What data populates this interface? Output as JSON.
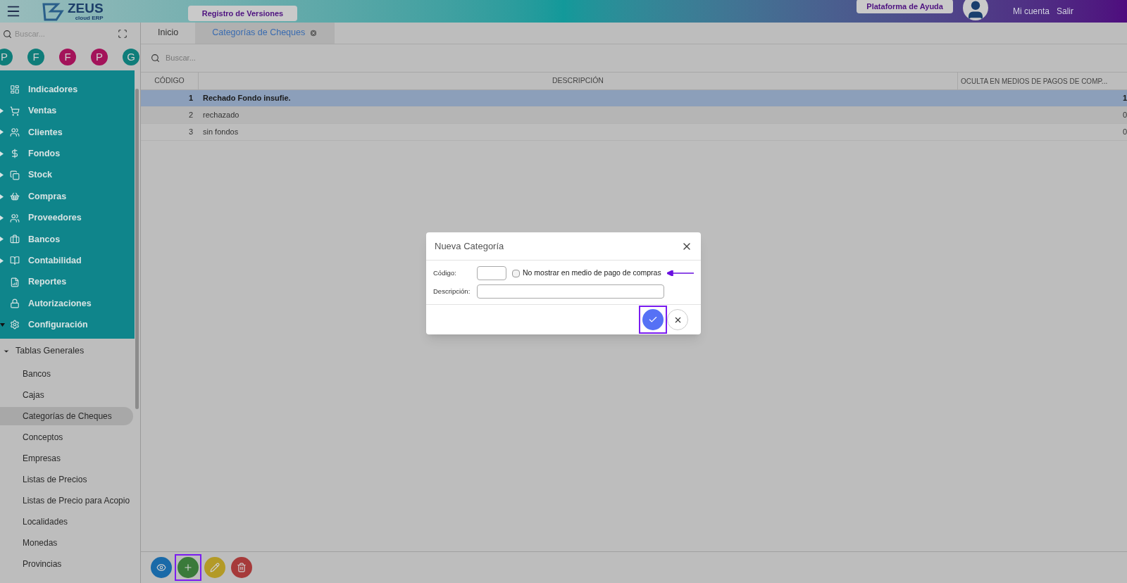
{
  "header": {
    "logo": {
      "name": "ZEUS",
      "tagline": "cloud ERP"
    },
    "versions_button": "Registro de Versiones",
    "help_button": "Plataforma de Ayuda",
    "links": [
      "Mi cuenta",
      "Salir"
    ]
  },
  "sidebar": {
    "search": {
      "placeholder": "Buscar..."
    },
    "avatars": [
      {
        "letter": "P",
        "color": "#0f7d7a"
      },
      {
        "letter": "F",
        "color": "#0f7d7a"
      },
      {
        "letter": "F",
        "color": "#a3135a"
      },
      {
        "letter": "P",
        "color": "#a3135a"
      },
      {
        "letter": "G",
        "color": "#0f7d7a"
      }
    ],
    "menu": [
      {
        "label": "Indicadores"
      },
      {
        "label": "Ventas",
        "expanded": false
      },
      {
        "label": "Clientes",
        "expanded": false
      },
      {
        "label": "Fondos",
        "expanded": false
      },
      {
        "label": "Stock",
        "expanded": false
      },
      {
        "label": "Compras",
        "expanded": false
      },
      {
        "label": "Proveedores",
        "expanded": false
      },
      {
        "label": "Bancos",
        "expanded": false
      },
      {
        "label": "Contabilidad",
        "expanded": false
      },
      {
        "label": "Reportes"
      },
      {
        "label": "Autorizaciones"
      },
      {
        "label": "Configuración",
        "expanded": true
      }
    ],
    "submenu": {
      "label": "Tablas Generales",
      "expanded": true,
      "children": [
        {
          "label": "Bancos",
          "selected": false
        },
        {
          "label": "Cajas",
          "selected": false
        },
        {
          "label": "Categorías de Cheques",
          "selected": true
        },
        {
          "label": "Conceptos",
          "selected": false
        },
        {
          "label": "Empresas",
          "selected": false
        },
        {
          "label": "Listas de Precios",
          "selected": false
        },
        {
          "label": "Listas de Precio para Acopio",
          "selected": false
        },
        {
          "label": "Localidades",
          "selected": false
        },
        {
          "label": "Monedas",
          "selected": false
        },
        {
          "label": "Provincias",
          "selected": false
        }
      ]
    }
  },
  "tabs": [
    {
      "label": "Inicio",
      "selected": false,
      "closable": false
    },
    {
      "label": "Categorías de Cheques",
      "selected": true,
      "closable": true
    }
  ],
  "search": {
    "placeholder": "Buscar..."
  },
  "table": {
    "columns": [
      "CÓDIGO",
      "DESCRIPCIÓN",
      "OCULTA EN MEDIOS DE PAGOS DE COMP..."
    ],
    "rows": [
      {
        "cells": [
          "1",
          "Rechado Fondo insufie.",
          "1"
        ],
        "selected": true
      },
      {
        "cells": [
          "2",
          "rechazado",
          "0"
        ],
        "selected": false
      },
      {
        "cells": [
          "3",
          "sin fondos",
          "0"
        ],
        "selected": false
      }
    ]
  },
  "toolbar": [
    {
      "kind": "view",
      "highlighted": false
    },
    {
      "kind": "add",
      "highlighted": true
    },
    {
      "kind": "edit",
      "highlighted": false
    },
    {
      "kind": "delete",
      "highlighted": false
    }
  ],
  "dialog": {
    "title": "Nueva Categoría",
    "fields": [
      {
        "label": "Código:"
      },
      {
        "label": "Descripción:"
      }
    ],
    "checkbox": {
      "label": "No mostrar en medio de pago de compras",
      "checked": false
    },
    "confirm_highlighted": true
  }
}
